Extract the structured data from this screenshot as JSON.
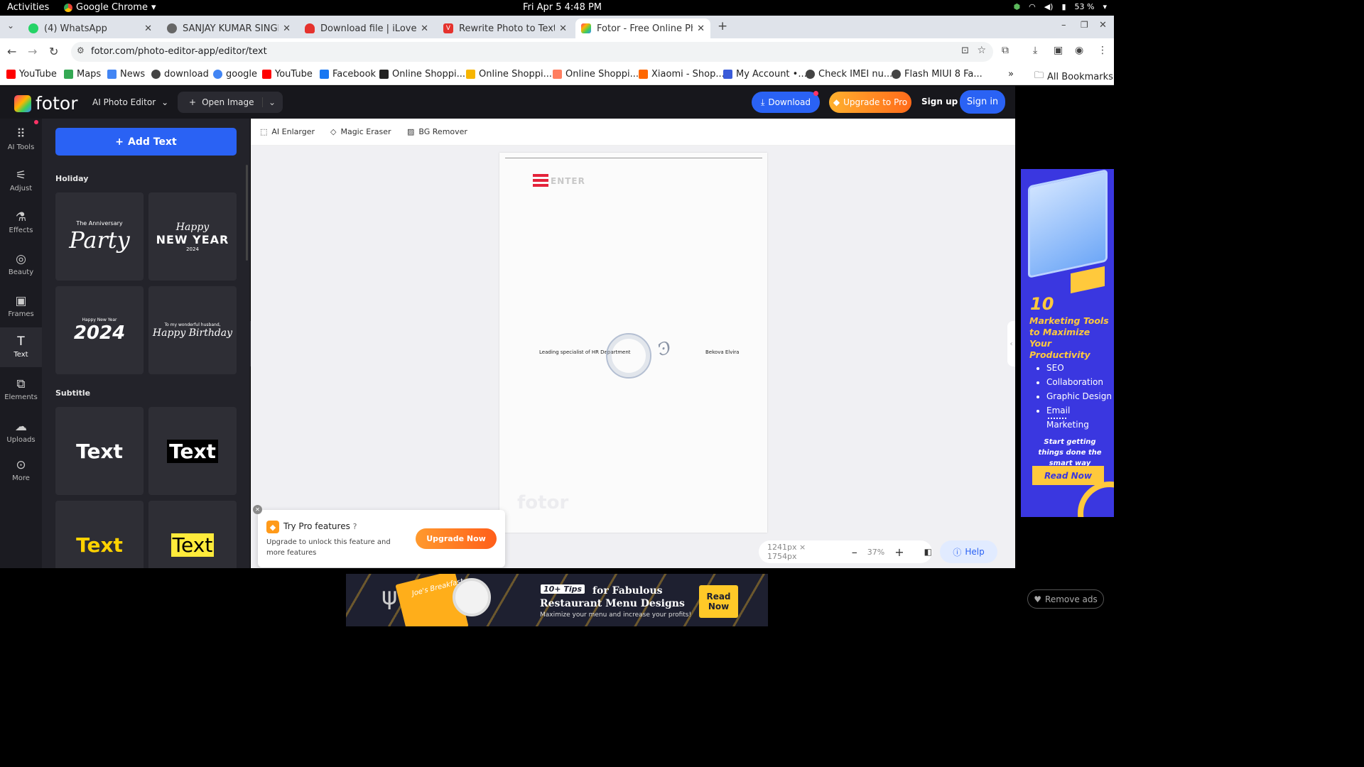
{
  "os": {
    "activities": "Activities",
    "app_name": "Google Chrome",
    "clock": "Fri Apr 5  4:48 PM",
    "battery": "53 %"
  },
  "tabs": [
    {
      "title": "(4) WhatsApp",
      "color": "#25d366"
    },
    {
      "title": "SANJAY KUMAR SINGH",
      "color": "#666666"
    },
    {
      "title": "Download file | iLovePDF",
      "color": "#e5322d"
    },
    {
      "title": "Rewrite Photo to Text, e",
      "color": "#e5322d"
    },
    {
      "title": "Fotor - Free Online Photo",
      "color": "#ff6a00"
    }
  ],
  "url": "fotor.com/photo-editor-app/editor/text",
  "bookmarks": [
    {
      "label": "YouTube",
      "color": "#ff0000"
    },
    {
      "label": "Maps",
      "color": "#34a853"
    },
    {
      "label": "News",
      "color": "#4285f4"
    },
    {
      "label": "download",
      "color": "#444444"
    },
    {
      "label": "google",
      "color": "#4285f4"
    },
    {
      "label": "YouTube",
      "color": "#ff0000"
    },
    {
      "label": "Facebook",
      "color": "#1877f2"
    },
    {
      "label": "Online Shoppi...",
      "color": "#222222"
    },
    {
      "label": "Online Shoppi...",
      "color": "#f7b500"
    },
    {
      "label": "Online Shoppi...",
      "color": "#ff7e5f"
    },
    {
      "label": "Xiaomi - Shop...",
      "color": "#ff6700"
    },
    {
      "label": "My Account •...",
      "color": "#3a5bd9"
    },
    {
      "label": "Check IMEI nu...",
      "color": "#444444"
    },
    {
      "label": "Flash MIUI 8 Fa...",
      "color": "#444444"
    }
  ],
  "all_bookmarks": "All Bookmarks",
  "fotor": {
    "logo": "fotor",
    "editor_menu": "AI Photo Editor",
    "open_image": "Open Image",
    "download": "Download",
    "upgrade": "Upgrade to Pro",
    "signup": "Sign up",
    "signin": "Sign in",
    "rail": [
      "AI Tools",
      "Adjust",
      "Effects",
      "Beauty",
      "Frames",
      "Text",
      "Elements",
      "Uploads",
      "More"
    ],
    "add_text": "Add Text",
    "section_holiday": "Holiday",
    "section_subtitle": "Subtitle",
    "holiday_cards": [
      {
        "small": "The Anniversary",
        "big": "Party"
      },
      {
        "small": "Happy",
        "big": "NEW YEAR",
        "sub": "2024"
      },
      {
        "small": "Happy New Year",
        "big": "2024"
      },
      {
        "small": "To my wonderful husband,",
        "big": "Happy Birthday"
      }
    ],
    "subtitle_cards": [
      "Text",
      "Text",
      "Text",
      "Text"
    ],
    "toolbar": [
      "AI Enlarger",
      "Magic Eraser",
      "BG Remover"
    ],
    "doc": {
      "company": "ENTER",
      "sign_role": "Leading specialist of HR Department",
      "sign_name": "Bekova Elvira",
      "watermark": "fotor"
    },
    "promo": {
      "title": "Try Pro features",
      "body": "Upgrade to unlock this feature and more features",
      "button": "Upgrade Now"
    },
    "image_size": "1241px × 1754px",
    "zoom": "37%",
    "help": "Help"
  },
  "right_ad": {
    "number": "10",
    "headline": "Marketing Tools to Maximize Your Productivity",
    "bullets": [
      "SEO",
      "Collaboration",
      "Graphic Design",
      "Email Marketing"
    ],
    "tagline": "Start getting things done the smart way",
    "cta": "Read Now"
  },
  "bottom_ad": {
    "badge": "10+ Tips",
    "headline1": "for Fabulous",
    "headline2": "Restaurant Menu Designs",
    "sub": "Maximize your menu and increase your profits!",
    "menu_label": "Joe's Breakfast",
    "cta": "Read Now"
  },
  "remove_ads": "Remove ads"
}
